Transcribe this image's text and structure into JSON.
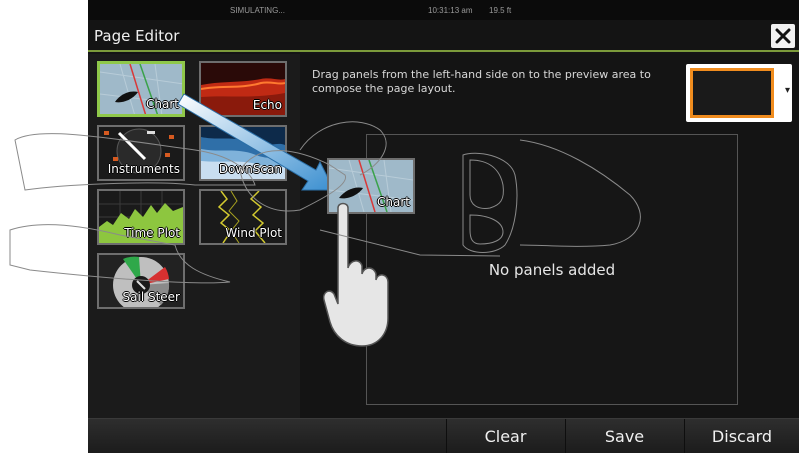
{
  "status_bar": {
    "simulating": "SIMULATING...",
    "time": "10:31:13 am",
    "depth": "19.5 ft"
  },
  "title": "Page Editor",
  "close_icon": "close-icon",
  "panels": [
    {
      "label": "Chart",
      "icon": "chart-thumbnail",
      "selected": true
    },
    {
      "label": "Echo",
      "icon": "echo-thumbnail",
      "selected": false
    },
    {
      "label": "Instruments",
      "icon": "instruments-thumbnail",
      "selected": false
    },
    {
      "label": "DownScan",
      "icon": "downscan-thumbnail",
      "selected": false
    },
    {
      "label": "Time Plot",
      "icon": "timeplot-thumbnail",
      "selected": false
    },
    {
      "label": "Wind Plot",
      "icon": "windplot-thumbnail",
      "selected": false
    },
    {
      "label": "Sail Steer",
      "icon": "sailsteer-thumbnail",
      "selected": false
    }
  ],
  "instruction": "Drag panels from the left-hand side on to the preview area to compose the page layout.",
  "layout_selector": {
    "accent": "#f08c1e"
  },
  "preview": {
    "empty_text": "No panels added"
  },
  "drag_tile": {
    "label": "Chart"
  },
  "buttons": {
    "clear": "Clear",
    "save": "Save",
    "discard": "Discard"
  },
  "colors": {
    "accent_green": "#7c9b3b",
    "selected_border": "#8fc84a",
    "drag_arrow": "#4a9ad6"
  }
}
